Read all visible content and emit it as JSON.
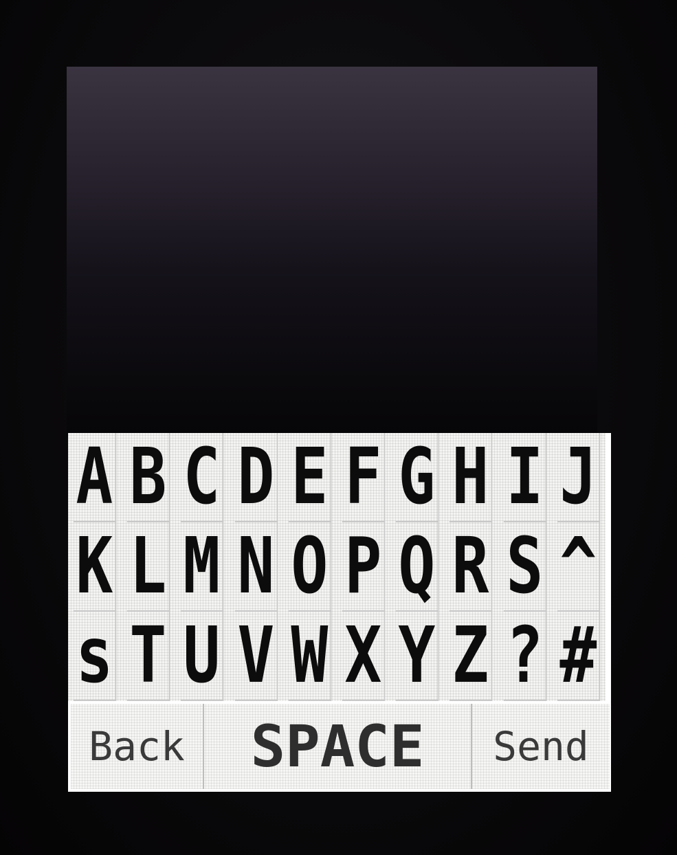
{
  "keyboard": {
    "rows": [
      [
        "A",
        "B",
        "C",
        "D",
        "E",
        "F",
        "G",
        "H",
        "I",
        "J"
      ],
      [
        "K",
        "L",
        "M",
        "N",
        "O",
        "P",
        "Q",
        "R",
        "S",
        "^"
      ],
      [
        "s",
        "T",
        "U",
        "V",
        "W",
        "X",
        "Y",
        "Z",
        "?",
        "#"
      ]
    ]
  },
  "actions": {
    "back_label": "Back",
    "space_label": "SPACE",
    "send_label": "Send"
  }
}
